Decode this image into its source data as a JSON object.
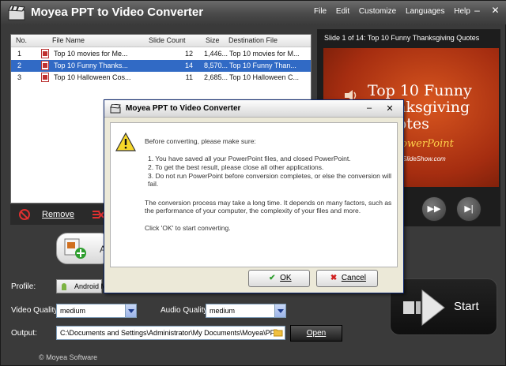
{
  "app": {
    "title": "Moyea PPT to Video Converter",
    "menu": [
      "File",
      "Edit",
      "Customize",
      "Languages",
      "Help"
    ]
  },
  "filelist": {
    "columns": [
      "No.",
      "File Name",
      "Slide Count",
      "Size",
      "Destination File"
    ],
    "rows": [
      {
        "no": "1",
        "name": "Top 10 movies for Me...",
        "slides": "12",
        "size": "1,446...",
        "dest": "Top 10 movies for M..."
      },
      {
        "no": "2",
        "name": "Top 10 Funny Thanks...",
        "slides": "14",
        "size": "8,570...",
        "dest": "Top 10 Funny Than..."
      },
      {
        "no": "3",
        "name": "Top 10 Halloween Cos...",
        "slides": "11",
        "size": "2,685...",
        "dest": "Top 10 Halloween C..."
      }
    ],
    "remove_label": "Remove"
  },
  "add_label": "A",
  "preview": {
    "title": "Slide 1 of 14: Top 10 Funny Thanksgiving Quotes",
    "slide_title_line1": "Top 10 Funny",
    "slide_title_line2": "Thanksgiving",
    "slide_title_line3": "Quotes",
    "slide_sub": "PowerPoint",
    "slide_url": "SlideShow.com"
  },
  "settings": {
    "profile_label": "Profile:",
    "profile_value": "Android M",
    "video_quality_label": "Video Quality:",
    "video_quality_value": "medium",
    "audio_quality_label": "Audio Quality:",
    "audio_quality_value": "medium",
    "output_label": "Output:",
    "output_value": "C:\\Documents and Settings\\Administrator\\My Documents\\Moyea\\PF",
    "open_label": "Open",
    "start_label": "Start"
  },
  "copyright": "© Moyea Software",
  "dialog": {
    "title": "Moyea PPT to Video Converter",
    "intro": "Before converting, please make sure:",
    "item1": "1. You have saved all your PowerPoint files, and closed PowerPoint.",
    "item2": "2. To get the best result, please close all other applications.",
    "item3": "3. Do not run PowerPoint before conversion completes, or else the conversion will fail.",
    "para": "The conversion process may take a long time. It depends on many factors, such as the performance of your computer, the complexity of your files and more.",
    "hint": "Click 'OK' to start converting.",
    "ok_label": "OK",
    "cancel_label": "Cancel"
  }
}
